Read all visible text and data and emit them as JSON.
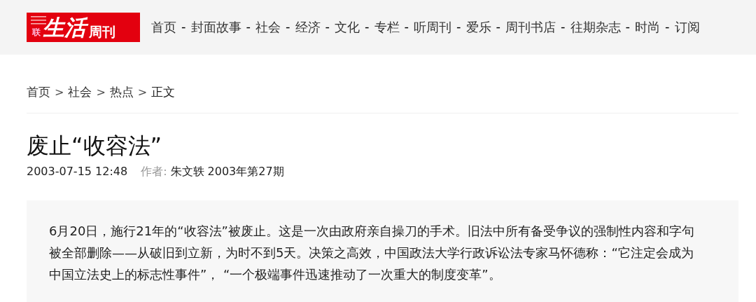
{
  "header": {
    "logo": {
      "small": "联",
      "main": "生活",
      "sub": "周刊"
    },
    "nav": [
      {
        "kind": "link",
        "label": "首页"
      },
      {
        "kind": "separator",
        "label": "-"
      },
      {
        "kind": "link",
        "label": "封面故事"
      },
      {
        "kind": "separator",
        "label": "-"
      },
      {
        "kind": "link",
        "label": "社会"
      },
      {
        "kind": "separator",
        "label": "-"
      },
      {
        "kind": "link",
        "label": "经济"
      },
      {
        "kind": "separator",
        "label": "-"
      },
      {
        "kind": "link",
        "label": "文化"
      },
      {
        "kind": "separator",
        "label": "-"
      },
      {
        "kind": "link",
        "label": "专栏"
      },
      {
        "kind": "separator",
        "label": "-"
      },
      {
        "kind": "link",
        "label": "听周刊"
      },
      {
        "kind": "separator",
        "label": "-"
      },
      {
        "kind": "link",
        "label": "爱乐"
      },
      {
        "kind": "separator",
        "label": "-"
      },
      {
        "kind": "link",
        "label": "周刊书店"
      },
      {
        "kind": "separator",
        "label": "-"
      },
      {
        "kind": "link",
        "label": "往期杂志"
      },
      {
        "kind": "separator",
        "label": "-"
      },
      {
        "kind": "link",
        "label": "时尚"
      },
      {
        "kind": "separator",
        "label": "-"
      },
      {
        "kind": "link",
        "label": "订阅"
      }
    ]
  },
  "breadcrumb": [
    {
      "kind": "link",
      "label": "首页"
    },
    {
      "kind": "separator",
      "label": ">"
    },
    {
      "kind": "link",
      "label": "社会"
    },
    {
      "kind": "separator",
      "label": ">"
    },
    {
      "kind": "link",
      "label": "热点"
    },
    {
      "kind": "separator",
      "label": ">"
    },
    {
      "kind": "current",
      "label": "正文"
    }
  ],
  "article": {
    "title": "废止“收容法”",
    "date": "2003-07-15 12:48",
    "author_label": "作者:",
    "author": "朱文轶",
    "issue": "2003年第27期",
    "summary": "6月20日，施行21年的“收容法”被废止。这是一次由政府亲自操刀的手术。旧法中所有备受争议的强制性内容和字句被全部删除——从破旧到立新，为时不到5天。决策之高效，中国政法大学行政诉讼法专家马怀德称：“它注定会成为中国立法史上的标志性事件”， “一个极端事件迅速推动了一次重大的制度变革”。"
  }
}
